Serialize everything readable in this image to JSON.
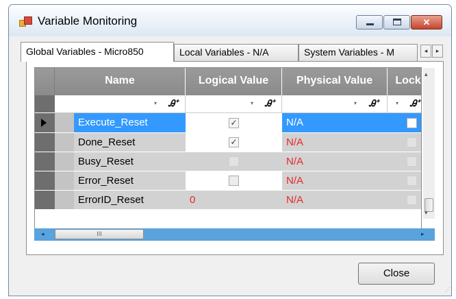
{
  "window": {
    "title": "Variable Monitoring"
  },
  "tabs": [
    {
      "label": "Global Variables - Micro850",
      "active": true
    },
    {
      "label": "Local Variables - N/A",
      "active": false
    },
    {
      "label": "System Variables - M",
      "active": false
    }
  ],
  "tab_scroll": {
    "left": "◂",
    "right": "▸"
  },
  "grid": {
    "columns": [
      "Name",
      "Logical Value",
      "Physical Value",
      "Lock"
    ],
    "filter_icon": "Ꭿ⁺",
    "filter_arrow": "▾",
    "rows": [
      {
        "name": "Execute_Reset",
        "logical": "checked",
        "physical": "N/A",
        "lock": "unchecked",
        "selected": true
      },
      {
        "name": "Done_Reset",
        "logical": "checked",
        "physical": "N/A",
        "lock": "disabled",
        "selected": false
      },
      {
        "name": "Busy_Reset",
        "logical": "disabled",
        "physical": "N/A",
        "lock": "disabled",
        "selected": false
      },
      {
        "name": "Error_Reset",
        "logical": "unchecked",
        "physical": "N/A",
        "lock": "disabled",
        "selected": false
      },
      {
        "name": "ErrorID_Reset",
        "logical": "0",
        "physical": "N/A",
        "lock": "disabled",
        "selected": false
      }
    ]
  },
  "scrollbar": {
    "thumb_grip": "III",
    "left_arrow": "◂",
    "right_arrow": "▸",
    "up_arrow": "▴",
    "down_arrow": "▾"
  },
  "buttons": {
    "close": "Close"
  },
  "colors": {
    "selection": "#3399ff",
    "error_text": "#e8262c",
    "header": "#939393",
    "row_header": "#6e6e6e"
  }
}
